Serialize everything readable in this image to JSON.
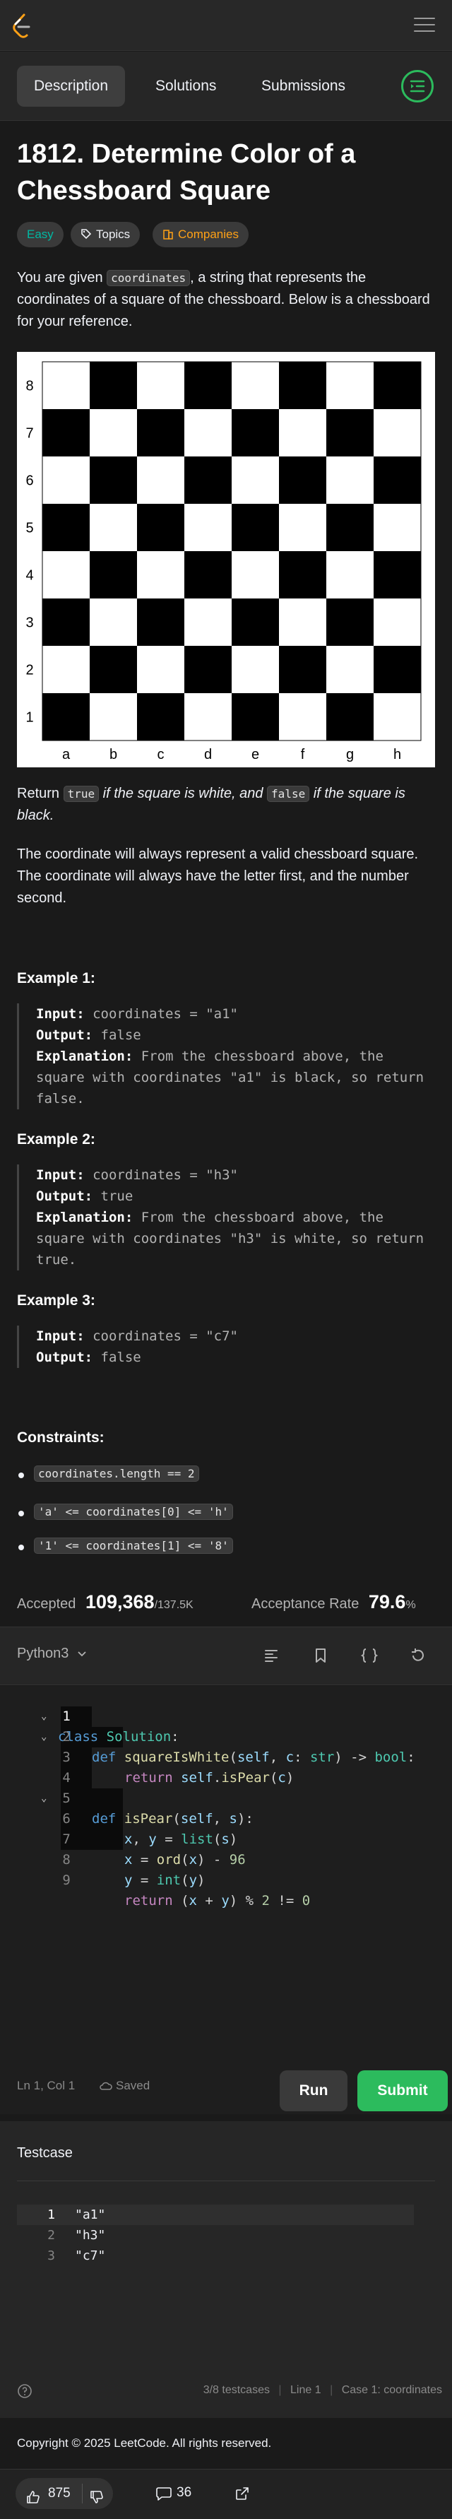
{
  "header": {
    "logo_icon": "leetcode-logo-icon",
    "menu_icon": "hamburger-menu-icon"
  },
  "tabs": [
    {
      "label": "Description",
      "active": true
    },
    {
      "label": "Solutions",
      "active": false
    },
    {
      "label": "Submissions",
      "active": false
    }
  ],
  "problem": {
    "title": "1812. Determine Color of a Chessboard Square",
    "difficulty": "Easy",
    "topics_label": "Topics",
    "companies_label": "Companies",
    "intro_1": "You are given ",
    "intro_code": "coordinates",
    "intro_2": ", a string that represents the coordinates of a square of the chessboard. Below is a chessboard for your reference.",
    "return_1": "Return ",
    "return_true": "true",
    "return_2": " if the square is white, and ",
    "return_false": "false",
    "return_3": " if the square is black.",
    "note": "The coordinate will always represent a valid chessboard square. The coordinate will always have the letter first, and the number second."
  },
  "board": {
    "files": [
      "a",
      "b",
      "c",
      "d",
      "e",
      "f",
      "g",
      "h"
    ],
    "ranks": [
      "8",
      "7",
      "6",
      "5",
      "4",
      "3",
      "2",
      "1"
    ],
    "light": "#ffffff",
    "dark": "#000000"
  },
  "examples": [
    {
      "title": "Example 1:",
      "input_label": "Input:",
      "input": "coordinates = \"a1\"",
      "output_label": "Output:",
      "output": "false",
      "explanation_label": "Explanation:",
      "explanation": "From the chessboard above, the square with coordinates \"a1\" is black, so return false."
    },
    {
      "title": "Example 2:",
      "input_label": "Input:",
      "input": "coordinates = \"h3\"",
      "output_label": "Output:",
      "output": "true",
      "explanation_label": "Explanation:",
      "explanation": "From the chessboard above, the square with coordinates \"h3\" is white, so return true."
    },
    {
      "title": "Example 3:",
      "input_label": "Input:",
      "input": "coordinates = \"c7\"",
      "output_label": "Output:",
      "output": "false"
    }
  ],
  "constraints": {
    "title": "Constraints:",
    "items": [
      "coordinates.length == 2",
      "'a' <= coordinates[0] <= 'h'",
      "'1' <= coordinates[1] <= '8'"
    ]
  },
  "stats": {
    "accepted_label": "Accepted",
    "accepted_value": "109,368",
    "accepted_total": "/137.5K",
    "rate_label": "Acceptance Rate",
    "rate_value": "79.6",
    "rate_unit": "%"
  },
  "editor": {
    "language": "Python3",
    "lines": [
      {
        "n": "1",
        "fold": true
      },
      {
        "n": "2",
        "fold": true
      },
      {
        "n": "3",
        "fold": false
      },
      {
        "n": "4",
        "fold": false
      },
      {
        "n": "5",
        "fold": true
      },
      {
        "n": "6",
        "fold": false
      },
      {
        "n": "7",
        "fold": false
      },
      {
        "n": "8",
        "fold": false
      },
      {
        "n": "9",
        "fold": false
      }
    ],
    "cursor_status": "Ln 1, Col 1",
    "saved_label": "Saved",
    "run_label": "Run",
    "submit_label": "Submit"
  },
  "code": {
    "l1_kw": "class",
    "l1_cls": "Solution",
    "l1_p": ":",
    "l2_kw": "def",
    "l2_fn": "squareIsWhite",
    "l2_a": "(",
    "l2_self": "self",
    "l2_b": ", ",
    "l2_c": "c",
    "l2_d": ": ",
    "l2_str": "str",
    "l2_e": ") -> ",
    "l2_bool": "bool",
    "l2_f": ":",
    "l3_kw": "return",
    "l3_self": "self",
    "l3_a": ".",
    "l3_fn": "isPear",
    "l3_b": "(",
    "l3_c": "c",
    "l3_d": ")",
    "l5_kw": "def",
    "l5_fn": "isPear",
    "l5_a": "(",
    "l5_self": "self",
    "l5_b": ", ",
    "l5_s": "s",
    "l5_c": "):",
    "l6_x": "x",
    "l6_a": ", ",
    "l6_y": "y",
    "l6_b": " = ",
    "l6_fn": "list",
    "l6_c": "(",
    "l6_s": "s",
    "l6_d": ")",
    "l7_x": "x",
    "l7_a": " = ",
    "l7_fn": "ord",
    "l7_b": "(",
    "l7_x2": "x",
    "l7_c": ") - ",
    "l7_num": "96",
    "l8_y": "y",
    "l8_a": " = ",
    "l8_fn": "int",
    "l8_b": "(",
    "l8_y2": "y",
    "l8_c": ")",
    "l9_kw": "return",
    "l9_a": " (",
    "l9_x": "x",
    "l9_b": " + ",
    "l9_y": "y",
    "l9_c": ") % ",
    "l9_n1": "2",
    "l9_d": " != ",
    "l9_n2": "0"
  },
  "testcase": {
    "title": "Testcase",
    "lines": [
      {
        "n": "1",
        "v": "\"a1\""
      },
      {
        "n": "2",
        "v": "\"h3\""
      },
      {
        "n": "3",
        "v": "\"c7\""
      }
    ],
    "status_count": "3/8 testcases",
    "status_line": "Line 1",
    "status_case": "Case 1: coordinates"
  },
  "footer": {
    "copyright": "Copyright © 2025 LeetCode. All rights reserved.",
    "likes": "875",
    "comments": "36"
  }
}
